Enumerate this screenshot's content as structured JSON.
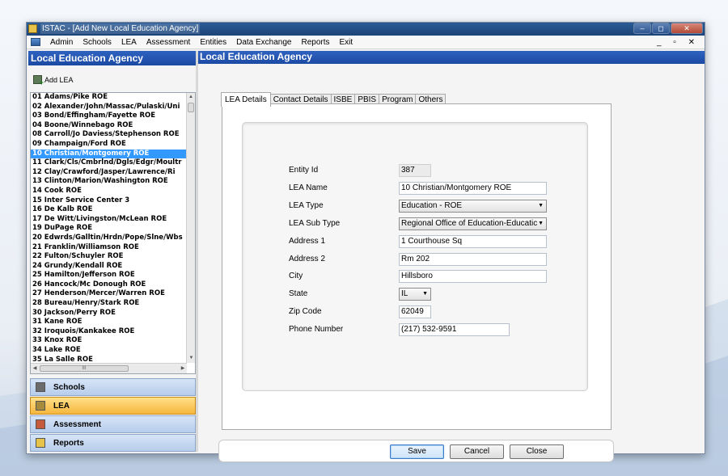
{
  "window": {
    "title": "ISTAC - [Add New Local Education Agency]",
    "controls": [
      "–",
      "◻",
      "✕"
    ]
  },
  "menu": {
    "items": [
      "Admin",
      "Schools",
      "LEA",
      "Assessment",
      "Entities",
      "Data Exchange",
      "Reports",
      "Exit"
    ],
    "mdi_controls": "_ ▫ ✕"
  },
  "left": {
    "header": "Local Education Agency",
    "add_label": "Add LEA",
    "selected_index": 6,
    "items": [
      "01 Adams/Pike ROE",
      "02 Alexander/John/Massac/Pulaski/Uni",
      "03 Bond/Effingham/Fayette ROE",
      "04 Boone/Winnebago ROE",
      "08 Carroll/Jo Daviess/Stephenson ROE",
      "09 Champaign/Ford ROE",
      "10 Christian/Montgomery ROE",
      "11 Clark/Cls/Cmbrlnd/Dgls/Edgr/Moultr",
      "12 Clay/Crawford/Jasper/Lawrence/Ri",
      "13 Clinton/Marion/Washington ROE",
      "14 Cook ROE",
      "15 Inter Service Center 3",
      "16 De Kalb ROE",
      "17 De Witt/Livingston/McLean ROE",
      "19 DuPage ROE",
      "20 Edwrds/Galltin/Hrdn/Pope/Slne/Wbs",
      "21 Franklin/Williamson ROE",
      "22 Fulton/Schuyler ROE",
      "24 Grundy/Kendall ROE",
      "25 Hamilton/Jefferson ROE",
      "26 Hancock/Mc Donough ROE",
      "27 Henderson/Mercer/Warren ROE",
      "28 Bureau/Henry/Stark ROE",
      "30 Jackson/Perry ROE",
      "31 Kane ROE",
      "32 Iroquois/Kankakee ROE",
      "33 Knox ROE",
      "34 Lake ROE",
      "35 La Salle ROE"
    ],
    "hscroll_thumb": "III",
    "nav": [
      {
        "label": "Schools",
        "icon": "school-icon",
        "color": "#6b6b6b"
      },
      {
        "label": "LEA",
        "icon": "lea-icon",
        "color": "#a88a3c",
        "active": true
      },
      {
        "label": "Assessment",
        "icon": "assessment-icon",
        "color": "#c55a3c"
      },
      {
        "label": "Reports",
        "icon": "reports-icon",
        "color": "#e6c34a"
      }
    ]
  },
  "right": {
    "header": "Local Education Agency",
    "tabs": [
      "LEA Details",
      "Contact Details",
      "ISBE",
      "PBIS",
      "Program",
      "Others"
    ],
    "active_tab": 0,
    "form": {
      "entity_id": {
        "label": "Entity Id",
        "value": "387"
      },
      "lea_name": {
        "label": "LEA Name",
        "value": "10 Christian/Montgomery ROE"
      },
      "lea_type": {
        "label": "LEA Type",
        "value": "Education - ROE"
      },
      "lea_sub_type": {
        "label": "LEA Sub Type",
        "value": "Regional Office of Education-Educatic"
      },
      "address1": {
        "label": "Address 1",
        "value": "1 Courthouse Sq"
      },
      "address2": {
        "label": "Address 2",
        "value": "Rm 202"
      },
      "city": {
        "label": "City",
        "value": "Hillsboro"
      },
      "state": {
        "label": "State",
        "value": "IL"
      },
      "zip": {
        "label": "Zip Code",
        "value": "62049"
      },
      "phone": {
        "label": "Phone Number",
        "value": "(217) 532-9591"
      }
    },
    "buttons": {
      "save": "Save",
      "cancel": "Cancel",
      "close": "Close"
    }
  }
}
